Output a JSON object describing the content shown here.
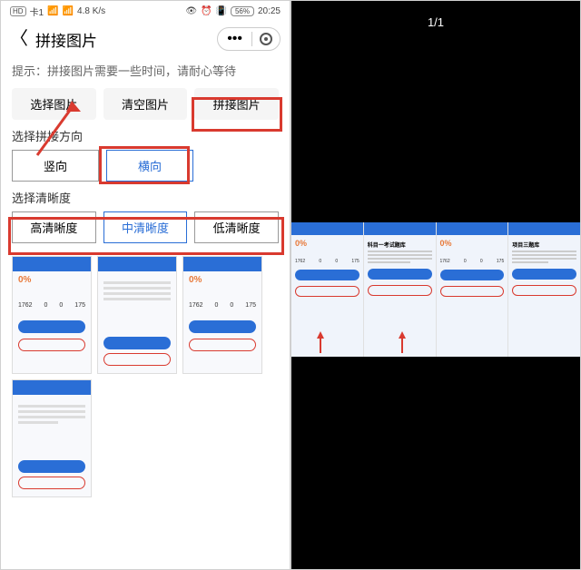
{
  "status": {
    "hd": "HD",
    "sim": "卡1",
    "speed": "4.8 K/s",
    "battery_pct": "56%",
    "time": "20:25"
  },
  "nav": {
    "title": "拼接图片"
  },
  "hint": "提示：拼接图片需要一些时间，请耐心等待",
  "actions": {
    "select": "选择图片",
    "clear": "清空图片",
    "stitch": "拼接图片"
  },
  "direction": {
    "label": "选择拼接方向",
    "vertical": "竖向",
    "horizontal": "横向"
  },
  "clarity": {
    "label": "选择清晰度",
    "high": "高清晰度",
    "mid": "中清晰度",
    "low": "低清晰度"
  },
  "thumb_stats": {
    "pct": "0%",
    "a": "1762",
    "b": "0",
    "c": "0",
    "d": "175"
  },
  "viewer": {
    "counter": "1/1"
  },
  "preview_blocks": {
    "title_a": "科目一考试题库",
    "title_b": "项目三题库"
  }
}
